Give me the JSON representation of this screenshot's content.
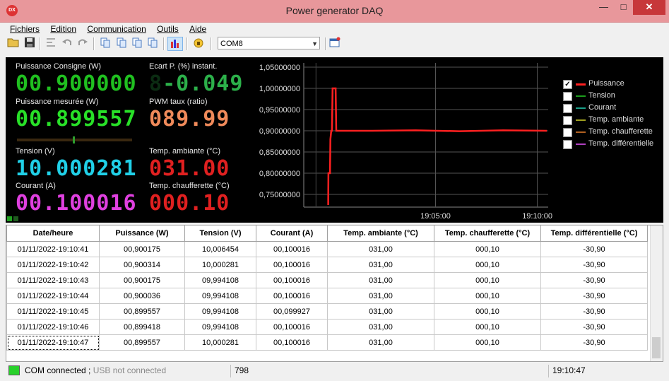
{
  "window": {
    "title": "Power generator DAQ",
    "app_icon": "DX",
    "minimize": "—",
    "maximize": "□",
    "close": "✕"
  },
  "menu": [
    {
      "label": "Fichiers"
    },
    {
      "label": "Edition"
    },
    {
      "label": "Communication"
    },
    {
      "label": "Outils"
    },
    {
      "label": "Aide"
    }
  ],
  "toolbar": {
    "icons": [
      "open-folder-icon",
      "save-icon",
      "align-icon",
      "undo-icon",
      "redo-icon",
      "copy-icon-1",
      "copy-icon-2",
      "copy-icon-3",
      "copy-icon-4",
      "chart-icon",
      "lock-icon",
      "new-window-icon"
    ],
    "port_select": "COM8"
  },
  "meters": {
    "puissance_consigne": {
      "label": "Puissance Consigne (W)",
      "value": "00.900000",
      "color": "#20c020"
    },
    "ecart": {
      "label": "Ecart P. (%) instant.",
      "value": "-0.049",
      "ghost": "8",
      "color": "#2cb04a"
    },
    "puissance_mesuree": {
      "label": "Puissance mesurée (W)",
      "value": "00.899557",
      "color": "#28e028"
    },
    "pwm": {
      "label": "PWM taux (ratio)",
      "value": "089.99",
      "color": "#f08a5a"
    },
    "tension": {
      "label": "Tension (V)",
      "value": "10.000281",
      "color": "#20d0e8"
    },
    "temp_ambiante": {
      "label": "Temp. ambiante (°C)",
      "value": "031.00",
      "color": "#e02020"
    },
    "courant": {
      "label": "Courant (A)",
      "value": "00.100016",
      "color": "#e040e0"
    },
    "temp_chaufferette": {
      "label": "Temp. chaufferette (°C)",
      "value": "000.10",
      "color": "#e02020"
    }
  },
  "chart_data": {
    "type": "line",
    "ylim": [
      0.72,
      1.06
    ],
    "y_ticks": [
      "1,05000000",
      "1,00000000",
      "0,95000000",
      "0,90000000",
      "0,85000000",
      "0,80000000",
      "0,75000000"
    ],
    "x_ticks": [
      "19:05:00",
      "19:10:00"
    ],
    "series": [
      {
        "name": "Puissance",
        "color": "#ff2020",
        "points": [
          [
            0.0,
            0.725
          ],
          [
            0.001,
            0.8
          ],
          [
            0.008,
            0.8
          ],
          [
            0.01,
            0.88
          ],
          [
            0.014,
            0.9
          ],
          [
            0.017,
            0.9
          ],
          [
            0.02,
            1.0
          ],
          [
            0.034,
            1.0
          ],
          [
            0.037,
            0.9
          ],
          [
            0.2,
            0.9
          ],
          [
            0.4,
            0.901
          ],
          [
            0.6,
            0.899
          ],
          [
            0.8,
            0.901
          ],
          [
            1.0,
            0.9
          ]
        ]
      }
    ]
  },
  "legend": [
    {
      "label": "Puissance",
      "color": "#ff2020",
      "checked": true
    },
    {
      "label": "Tension",
      "color": "#1c9e1c",
      "checked": false
    },
    {
      "label": "Courant",
      "color": "#1aa088",
      "checked": false
    },
    {
      "label": "Temp. ambiante",
      "color": "#a0a020",
      "checked": false
    },
    {
      "label": "Temp. chaufferette",
      "color": "#b06020",
      "checked": false
    },
    {
      "label": "Temp. différentielle",
      "color": "#b040c0",
      "checked": false
    }
  ],
  "table": {
    "columns": [
      "Date/heure",
      "Puissance (W)",
      "Tension (V)",
      "Courant (A)",
      "Temp. ambiante (°C)",
      "Temp. chaufferette (°C)",
      "Temp. différentielle (°C)"
    ],
    "rows": [
      [
        "01/11/2022-19:10:41",
        "00,900175",
        "10,006454",
        "00,100016",
        "031,00",
        "000,10",
        "-30,90"
      ],
      [
        "01/11/2022-19:10:42",
        "00,900314",
        "10,000281",
        "00,100016",
        "031,00",
        "000,10",
        "-30,90"
      ],
      [
        "01/11/2022-19:10:43",
        "00,900175",
        "09,994108",
        "00,100016",
        "031,00",
        "000,10",
        "-30,90"
      ],
      [
        "01/11/2022-19:10:44",
        "00,900036",
        "09,994108",
        "00,100016",
        "031,00",
        "000,10",
        "-30,90"
      ],
      [
        "01/11/2022-19:10:45",
        "00,899557",
        "09,994108",
        "00,099927",
        "031,00",
        "000,10",
        "-30,90"
      ],
      [
        "01/11/2022-19:10:46",
        "00,899418",
        "09,994108",
        "00,100016",
        "031,00",
        "000,10",
        "-30,90"
      ],
      [
        "01/11/2022-19:10:47",
        "00,899557",
        "10,000281",
        "00,100016",
        "031,00",
        "000,10",
        "-30,90"
      ]
    ]
  },
  "status": {
    "com": "COM connected",
    "sep": " ; ",
    "usb": "USB not connected",
    "count": "798",
    "time": "19:10:47",
    "led_color": "#28d12b"
  }
}
